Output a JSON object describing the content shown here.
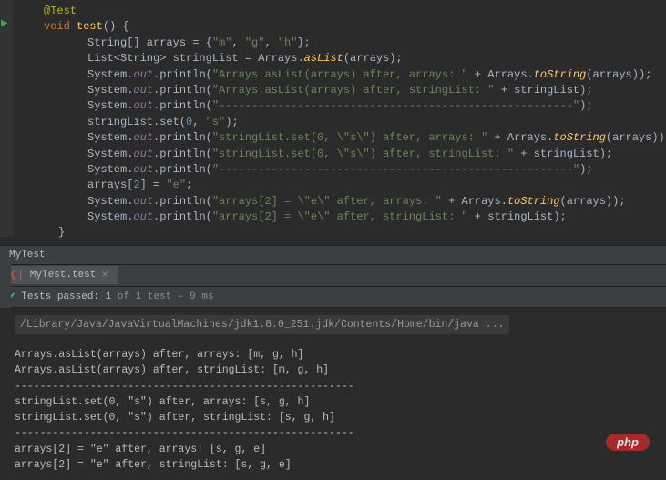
{
  "code": {
    "annotation": "@Test",
    "signature_keyword": "void",
    "signature_method": "test",
    "signature_parens": "() {",
    "line3_a": "String[] arrays = {",
    "line3_str_m": "\"m\"",
    "line3_comma1": ", ",
    "line3_str_g": "\"g\"",
    "line3_comma2": ", ",
    "line3_str_h": "\"h\"",
    "line3_b": "};",
    "line4_a": "List<String> stringList = Arrays.",
    "line4_m": "asList",
    "line4_b": "(arrays);",
    "line5_a": "System.",
    "line5_out": "out",
    "line5_b": ".println(",
    "line5_str": "\"Arrays.asList(arrays) after, arrays: \"",
    "line5_c": " + Arrays.",
    "line5_ts": "toString",
    "line5_d": "(arrays));",
    "line6_str": "\"Arrays.asList(arrays) after, stringList: \"",
    "line6_d": " + stringList);",
    "line7_str": "\"------------------------------------------------------\"",
    "line7_d": ");",
    "line8_a": "stringList.set(",
    "line8_n": "0",
    "line8_b": ", ",
    "line8_s": "\"s\"",
    "line8_c": ");",
    "line9_str": "\"stringList.set(0, \\\"s\\\") after, arrays: \"",
    "line10_str": "\"stringList.set(0, \\\"s\\\") after, stringList: \"",
    "line12_a": "arrays[",
    "line12_n": "2",
    "line12_b": "] = ",
    "line12_s": "\"e\"",
    "line12_c": ";",
    "line13_str": "\"arrays[2] = \\\"e\\\" after, arrays: \"",
    "line14_str": "\"arrays[2] = \\\"e\\\" after, stringList: \"",
    "close_brace": "}"
  },
  "breadcrumb": "MyTest",
  "tab": {
    "icon": "❬❘",
    "label": "MyTest.test",
    "close": "×"
  },
  "test_status": {
    "check": "✔",
    "prefix": "Tests passed:",
    "count": " 1 ",
    "suffix": "of 1 test – 9 ms"
  },
  "console": {
    "cmd": "/Library/Java/JavaVirtualMachines/jdk1.8.0_251.jdk/Contents/Home/bin/java ...",
    "l1": "Arrays.asList(arrays) after, arrays: [m, g, h]",
    "l2": "Arrays.asList(arrays) after, stringList: [m, g, h]",
    "l3": "------------------------------------------------------",
    "l4": "stringList.set(0, \"s\") after, arrays: [s, g, h]",
    "l5": "stringList.set(0, \"s\") after, stringList: [s, g, h]",
    "l6": "------------------------------------------------------",
    "l7": "arrays[2] = \"e\" after, arrays: [s, g, e]",
    "l8": "arrays[2] = \"e\" after, stringList: [s, g, e]"
  },
  "watermark": "php"
}
